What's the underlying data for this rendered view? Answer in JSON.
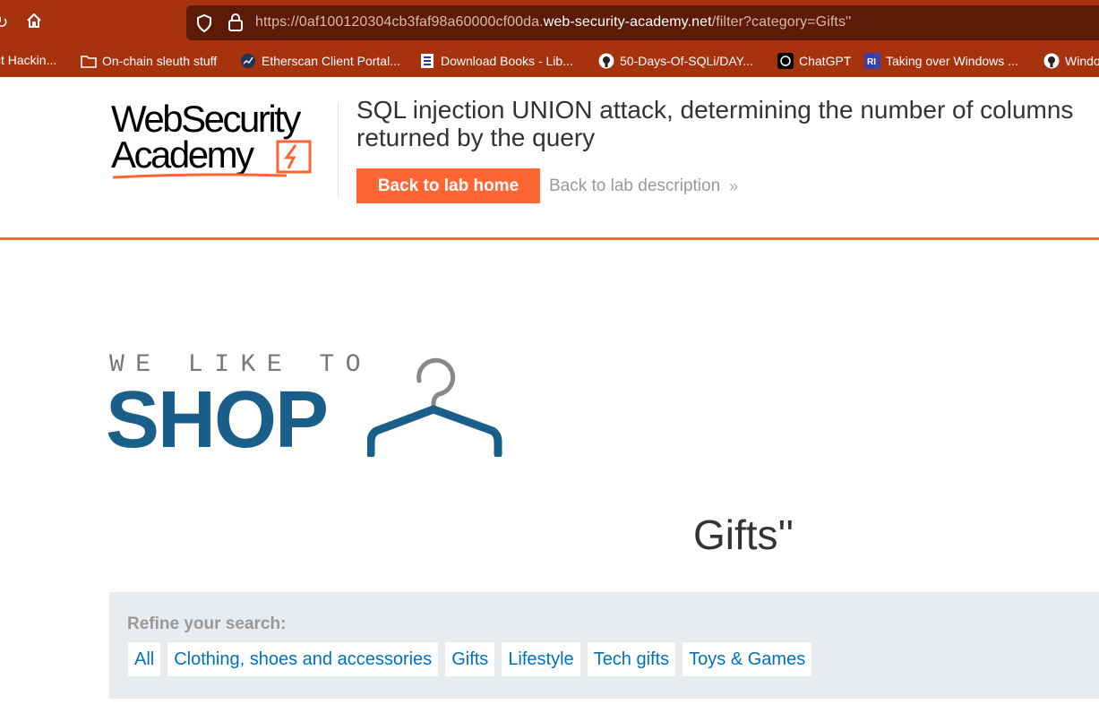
{
  "browser": {
    "url_prefix": "https://0af100120304cb3faf98a60000cf00da.",
    "url_domain": "web-security-academy.net",
    "url_path": "/filter?category=Gifts''",
    "toolbar_color": "#a9320e"
  },
  "bookmarks": [
    {
      "label": "ct Hackin...",
      "icon": "none"
    },
    {
      "label": "On-chain sleuth stuff",
      "icon": "folder-icon"
    },
    {
      "label": "Etherscan Client Portal...",
      "icon": "etherscan-icon"
    },
    {
      "label": "Download Books - Lib...",
      "icon": "book-icon"
    },
    {
      "label": "50-Days-Of-SQLi/DAY...",
      "icon": "github-icon"
    },
    {
      "label": "ChatGPT",
      "icon": "chatgpt-icon"
    },
    {
      "label": "Taking over Windows ...",
      "icon": "site-icon"
    },
    {
      "label": "Windo",
      "icon": "github-icon"
    }
  ],
  "academy": {
    "logo_line1": "WebSecurity",
    "logo_line2": "Academy",
    "lab_title_line1": "SQL injection UNION attack, determining the number of columns",
    "lab_title_line2": "returned by the query",
    "back_home_label": "Back to lab home",
    "back_description_label": "Back to lab description",
    "accent_color": "#ff6633"
  },
  "shop": {
    "tagline": "WE LIKE TO",
    "name": "SHOP",
    "brand_color": "#1a5f8a"
  },
  "main": {
    "heading": "Gifts''",
    "refine_label": "Refine your search:",
    "filters": [
      "All",
      "Clothing, shoes and accessories",
      "Gifts",
      "Lifestyle",
      "Tech gifts",
      "Toys & Games"
    ]
  }
}
